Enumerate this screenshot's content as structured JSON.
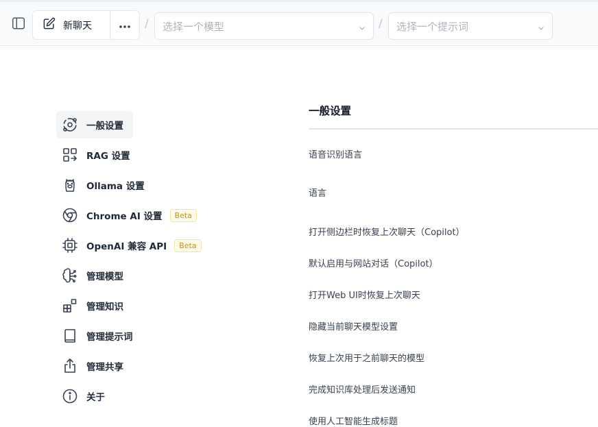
{
  "header": {
    "new_chat_label": "新聊天",
    "separator": "/",
    "model_select_placeholder": "选择一个模型",
    "prompt_select_placeholder": "选择一个提示词"
  },
  "nav": {
    "items": [
      {
        "label": "一般设置",
        "icon": "settings-orbit-icon",
        "active": true
      },
      {
        "label": "RAG 设置",
        "icon": "rag-icon"
      },
      {
        "label": "Ollama 设置",
        "icon": "llama-icon"
      },
      {
        "label": "Chrome AI 设置",
        "icon": "chrome-icon",
        "badge": "Beta"
      },
      {
        "label": "OpenAI 兼容 API",
        "icon": "cpu-chip-icon",
        "badge": "Beta"
      },
      {
        "label": "管理模型",
        "icon": "brain-icon"
      },
      {
        "label": "管理知识",
        "icon": "blocks-icon"
      },
      {
        "label": "管理提示词",
        "icon": "book-icon"
      },
      {
        "label": "管理共享",
        "icon": "share-icon"
      },
      {
        "label": "关于",
        "icon": "info-icon"
      }
    ]
  },
  "content": {
    "section_title": "一般设置",
    "settings": [
      "语音识别语言",
      "语言",
      "打开侧边栏时恢复上次聊天（Copilot）",
      "默认启用与网站对话（Copilot）",
      "打开Web UI时恢复上次聊天",
      "隐藏当前聊天模型设置",
      "恢复上次用于之前聊天的模型",
      "完成知识库处理后发送通知",
      "使用人工智能生成标题"
    ]
  },
  "colors": {
    "topbar_bg": "#f9fafb",
    "active_nav_bg": "#f3f4f6",
    "beta_text": "#b7902b",
    "beta_bg": "#fefbe6"
  }
}
